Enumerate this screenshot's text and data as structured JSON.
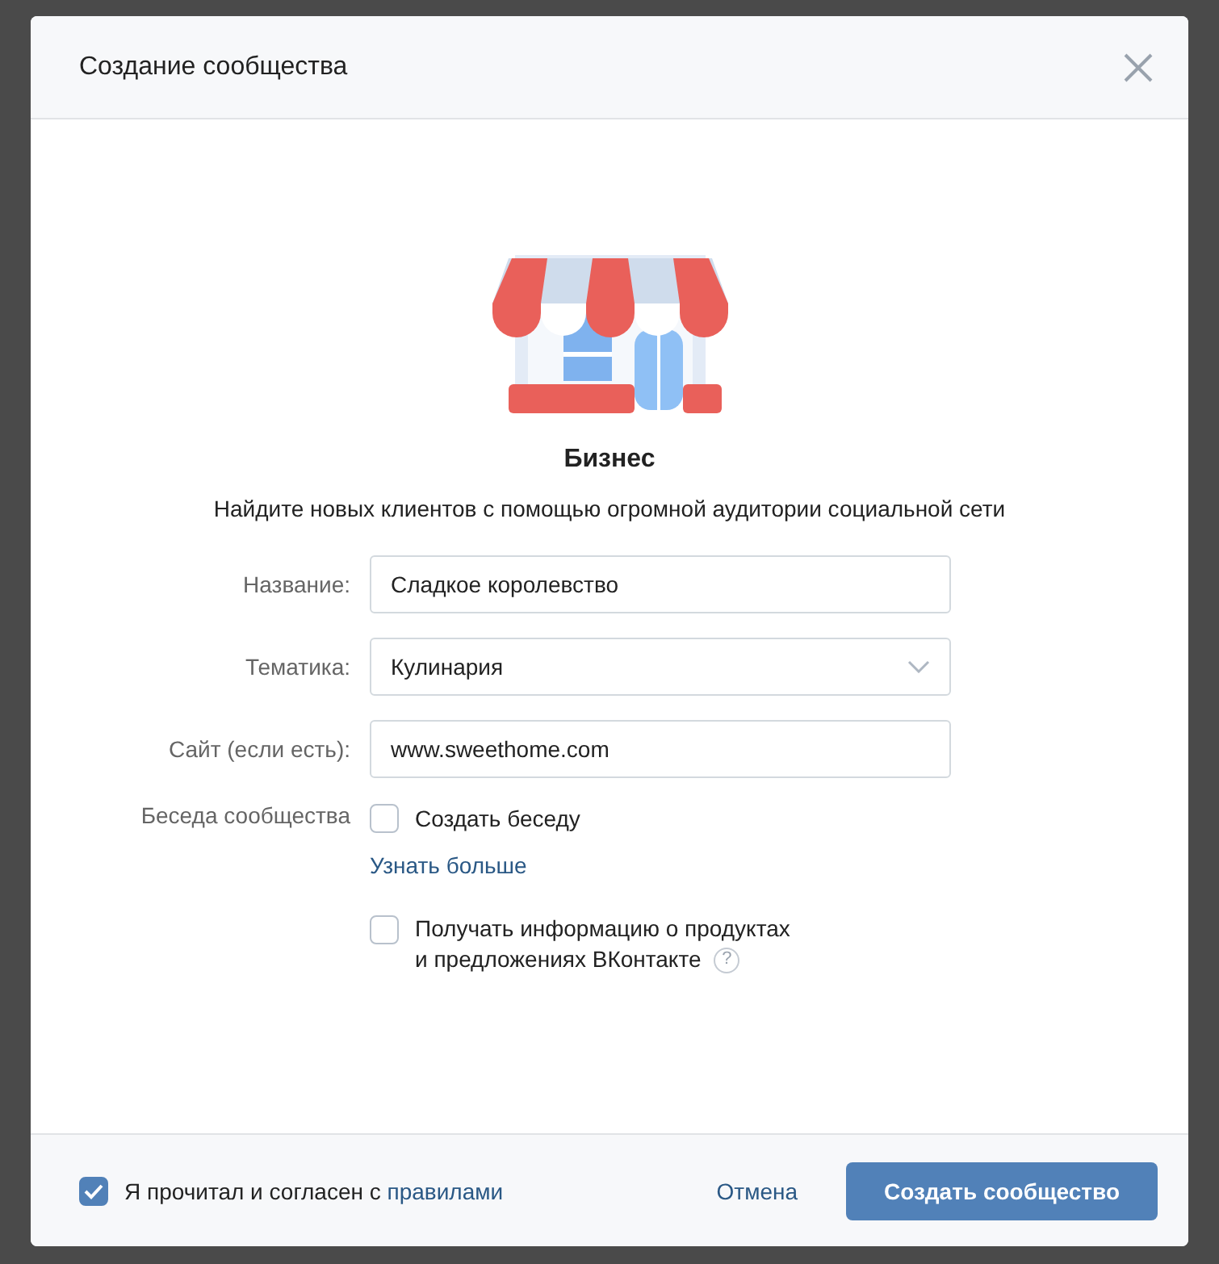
{
  "window": {
    "title": "Создание сообщества"
  },
  "category": {
    "title": "Бизнес",
    "description": "Найдите новых клиентов с помощью огромной аудитории социальной сети"
  },
  "fields": [
    {
      "kind": "text",
      "label": "Название:",
      "value": "Сладкое королевство"
    },
    {
      "kind": "select",
      "label": "Тематика:",
      "value": "Кулинария"
    },
    {
      "kind": "text",
      "label": "Сайт (если есть):",
      "value": "www.sweethome.com"
    }
  ],
  "chat": {
    "label": "Беседа сообщества",
    "checkbox": "Создать беседу",
    "checked": false,
    "link": "Узнать больше"
  },
  "subscribe": {
    "lines": [
      "Получать информацию о продуктах",
      "и предложениях ВКонтакте"
    ],
    "checked": false,
    "help": "?"
  },
  "footer": {
    "agree_text": "Я прочитал и согласен с",
    "agree_link": "правилами",
    "checked": true,
    "cancel": "Отмена",
    "submit": "Создать сообщество"
  }
}
